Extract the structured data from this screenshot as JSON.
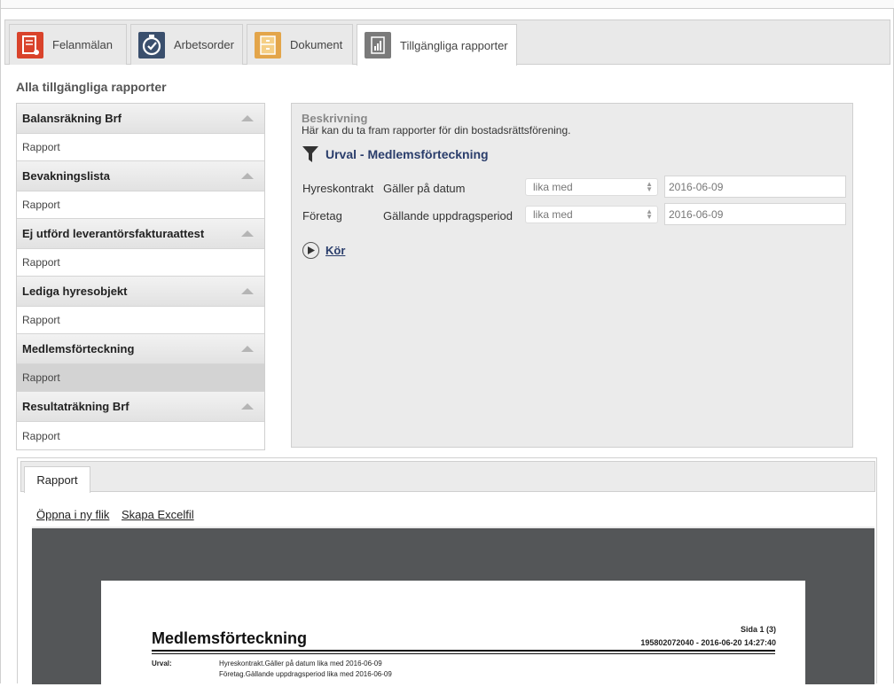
{
  "tabs": [
    {
      "label": "Felanmälan",
      "icon": "fault-report-icon",
      "color": "#d9432b"
    },
    {
      "label": "Arbetsorder",
      "icon": "work-order-icon",
      "color": "#3a4f6d"
    },
    {
      "label": "Dokument",
      "icon": "document-icon",
      "color": "#e3a54a"
    },
    {
      "label": "Tillgängliga rapporter",
      "icon": "report-icon",
      "color": "#7a7a7a"
    }
  ],
  "section_title": "Alla tillgängliga rapporter",
  "reports": [
    {
      "title": "Balansräkning Brf",
      "item": "Rapport"
    },
    {
      "title": "Bevakningslista",
      "item": "Rapport"
    },
    {
      "title": "Ej utförd leverantörsfakturaattest",
      "item": "Rapport"
    },
    {
      "title": "Lediga hyresobjekt",
      "item": "Rapport"
    },
    {
      "title": "Medlemsförteckning",
      "item": "Rapport"
    },
    {
      "title": "Resultaträkning Brf",
      "item": "Rapport"
    }
  ],
  "selected_report": "Medlemsförteckning",
  "description": {
    "title": "Beskrivning",
    "text": "Här kan du ta fram rapporter för din bostadsrättsförening.",
    "urval_title": "Urval - Medlemsförteckning",
    "rows": [
      {
        "entity": "Hyreskontrakt",
        "field": "Gäller på datum",
        "operator": "lika med",
        "value": "2016-06-09"
      },
      {
        "entity": "Företag",
        "field": "Gällande uppdragsperiod",
        "operator": "lika med",
        "value": "2016-06-09"
      }
    ],
    "run_label": "Kör"
  },
  "report_panel": {
    "tab_label": "Rapport",
    "open_new_tab": "Öppna i ny flik",
    "create_excel": "Skapa Excelfil",
    "document": {
      "title": "Medlemsförteckning",
      "page": "Sida 1 (3)",
      "meta": "195802072040 - 2016-06-20 14:27:40",
      "urval_label": "Urval:",
      "urval_lines": [
        "Hyreskontrakt.Gäller på datum lika med 2016-06-09",
        "Företag.Gällande uppdragsperiod lika med 2016-06-09"
      ]
    }
  }
}
